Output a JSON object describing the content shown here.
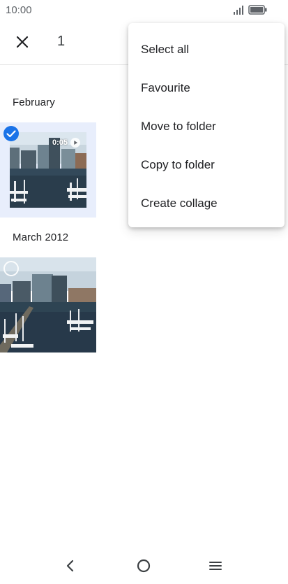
{
  "status_bar": {
    "time": "10:00"
  },
  "app_bar": {
    "selected_count": "1"
  },
  "sections": [
    {
      "label": "February",
      "items": [
        {
          "duration": "0:05",
          "selected": true
        }
      ]
    },
    {
      "label": "March 2012",
      "items": [
        {
          "selected": false
        }
      ]
    }
  ],
  "menu": {
    "items": [
      {
        "label": "Select all"
      },
      {
        "label": "Favourite"
      },
      {
        "label": "Move to folder"
      },
      {
        "label": "Copy to folder"
      },
      {
        "label": "Create collage"
      }
    ]
  },
  "icons": {
    "close": "close-icon",
    "check": "check-circle-icon",
    "unchecked": "empty-circle-icon",
    "play": "play-icon",
    "back": "back-icon",
    "home": "home-icon",
    "recents": "menu-icon"
  },
  "colors": {
    "accent": "#1a73e8",
    "selected_bg": "#e8eefc"
  }
}
